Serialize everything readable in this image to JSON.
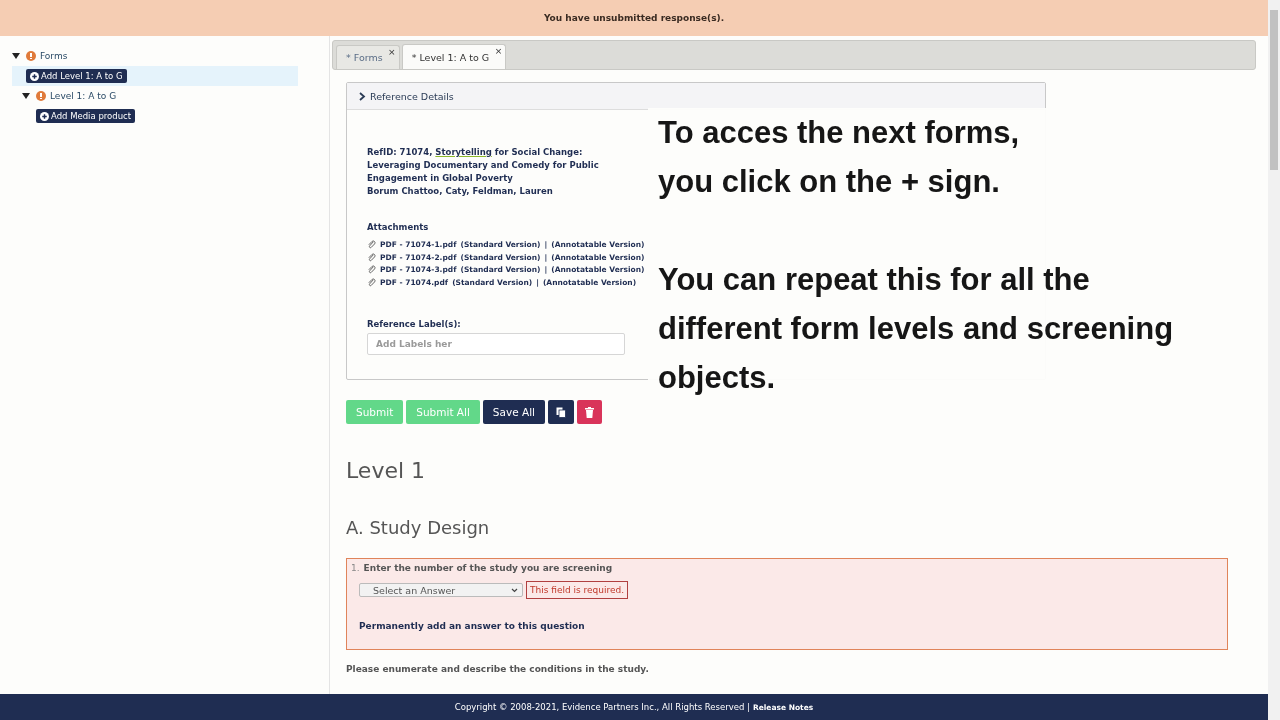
{
  "banner": {
    "text": "You have unsubmitted response(s)."
  },
  "tree": [
    {
      "kind": "node",
      "label": "Forms",
      "expanded": true,
      "warning": true,
      "children": [
        {
          "kind": "add",
          "label": "Add Level 1: A to G",
          "selected": true
        },
        {
          "kind": "node",
          "label": "Level 1: A to G",
          "expanded": true,
          "warning": true,
          "children": [
            {
              "kind": "add",
              "label": "Add Media product",
              "selected": false
            }
          ]
        }
      ]
    }
  ],
  "tabs": [
    {
      "label": "* Forms",
      "selected": false,
      "close": "×"
    },
    {
      "label": "* Level 1: A to G",
      "selected": true,
      "close": "×"
    }
  ],
  "reference": {
    "header": "Reference Details",
    "expanded": false,
    "title_prefix": "RefID: 71074, ",
    "title_underlined": "Storytelling",
    "title_rest": " for Social Change: Leveraging Documentary and Comedy for Public Engagement in Global Poverty",
    "authors": "Borum Chattoo, Caty, Feldman, Lauren",
    "attachments_label": "Attachments",
    "attachments": [
      {
        "file": "PDF - 71074-1.pdf",
        "standard": "(Standard Version)",
        "separator": "|",
        "annotatable": "(Annotatable Version)"
      },
      {
        "file": "PDF - 71074-2.pdf",
        "standard": "(Standard Version)",
        "separator": "|",
        "annotatable": "(Annotatable Version)"
      },
      {
        "file": "PDF - 71074-3.pdf",
        "standard": "(Standard Version)",
        "separator": "|",
        "annotatable": "(Annotatable Version)"
      },
      {
        "file": "PDF - 71074.pdf",
        "standard": "(Standard Version)",
        "separator": "|",
        "annotatable": "(Annotatable Version)"
      }
    ],
    "labels_label": "Reference Label(s):",
    "labels_placeholder": "Add Labels her"
  },
  "caption": [
    {
      "lines": [
        "To acces the next forms,",
        "you click on the + sign."
      ]
    },
    {
      "lines": [
        "You can repeat this for all the",
        "different form levels and screening",
        "objects."
      ]
    }
  ],
  "actions": [
    {
      "kind": "submit",
      "label": "Submit",
      "disabled": true
    },
    {
      "kind": "submit",
      "label": "Submit All",
      "disabled": true
    },
    {
      "kind": "save",
      "label": "Save All",
      "disabled": false
    },
    {
      "kind": "copy",
      "disabled": false
    },
    {
      "kind": "delete",
      "disabled": false
    }
  ],
  "level_title": "Level 1",
  "section_title": "A. Study Design",
  "question": {
    "number": "1.",
    "text": "Enter the number of the study you are screening",
    "placeholder": "Select an Answer",
    "error": "This field is required.",
    "link": "Permanently add an answer to this question"
  },
  "next_question": "Please enumerate and describe the conditions in the study.",
  "footer": {
    "text": "Copyright © 2008-2021, Evidence Partners Inc., All Rights Reserved |",
    "link": "Release Notes"
  }
}
